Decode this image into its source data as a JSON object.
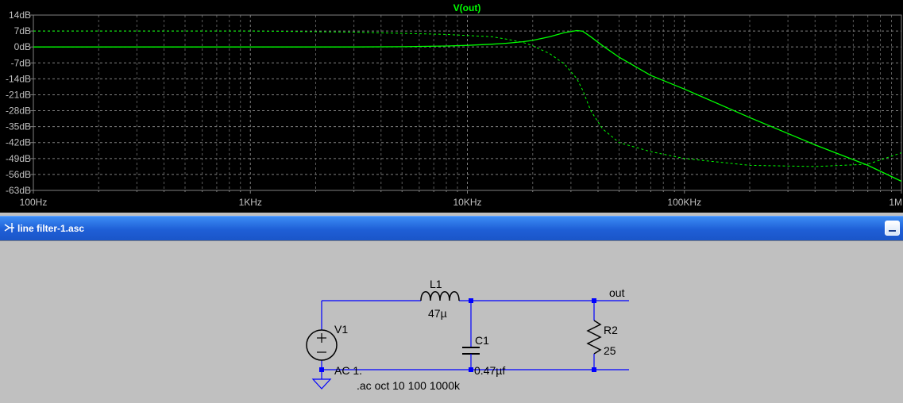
{
  "plot": {
    "trace_name": "V(out)",
    "trace_color": "#00ff00",
    "background": "#000000",
    "grid_color": "#808080",
    "y_tick_labels": [
      "14dB",
      "7dB",
      "0dB",
      "-7dB",
      "-14dB",
      "-21dB",
      "-28dB",
      "-35dB",
      "-42dB",
      "-49dB",
      "-56dB",
      "-63dB"
    ],
    "x_tick_labels": [
      "100Hz",
      "1KHz",
      "10KHz",
      "100KHz",
      "1MHz"
    ]
  },
  "chart_data": {
    "type": "line",
    "title": "V(out)",
    "xlabel": "",
    "ylabel": "",
    "x_scale": "log",
    "xlim": [
      100,
      1000000
    ],
    "ylim": [
      -63,
      14
    ],
    "grid": true,
    "series": [
      {
        "name": "V(out)",
        "style": "solid",
        "x": [
          100,
          1000,
          3000,
          5000,
          8000,
          10000,
          13000,
          15000,
          18000,
          20000,
          24000,
          28000,
          32000,
          34000,
          37000,
          42000,
          50000,
          70000,
          100000,
          200000,
          400000,
          700000,
          1000000
        ],
        "y": [
          0,
          0,
          0,
          0.1,
          0.4,
          0.7,
          1.2,
          1.6,
          2.3,
          2.9,
          4.5,
          6.3,
          7.2,
          6.9,
          4.5,
          0.5,
          -4.5,
          -12.5,
          -18.5,
          -31,
          -43,
          -52,
          -59
        ]
      },
      {
        "name": "",
        "style": "dashed",
        "x": [
          100,
          1000,
          3000,
          5000,
          8000,
          10000,
          13000,
          15000,
          18000,
          20000,
          24000,
          28000,
          32000,
          34000,
          37000,
          42000,
          50000,
          70000,
          100000,
          200000,
          400000,
          700000,
          1000000
        ],
        "y": [
          7,
          7,
          6.5,
          6,
          5.5,
          5,
          4.5,
          3.5,
          2,
          0.5,
          -3,
          -7.5,
          -14,
          -19,
          -28,
          -36,
          -42,
          -46,
          -49,
          -52,
          -52.5,
          -51.5,
          -46.5
        ]
      }
    ]
  },
  "window": {
    "title": "line filter-1.asc"
  },
  "schematic": {
    "wire_color": "#0000ff",
    "labels": {
      "l1_name": "L1",
      "l1_value": "47µ",
      "c1_name": "C1",
      "c1_value": "0.47µf",
      "r2_name": "R2",
      "r2_value": "25",
      "v1_name": "V1",
      "v1_value": "AC 1.",
      "net_out": "out",
      "directive": ".ac oct 10 100 1000k"
    }
  }
}
